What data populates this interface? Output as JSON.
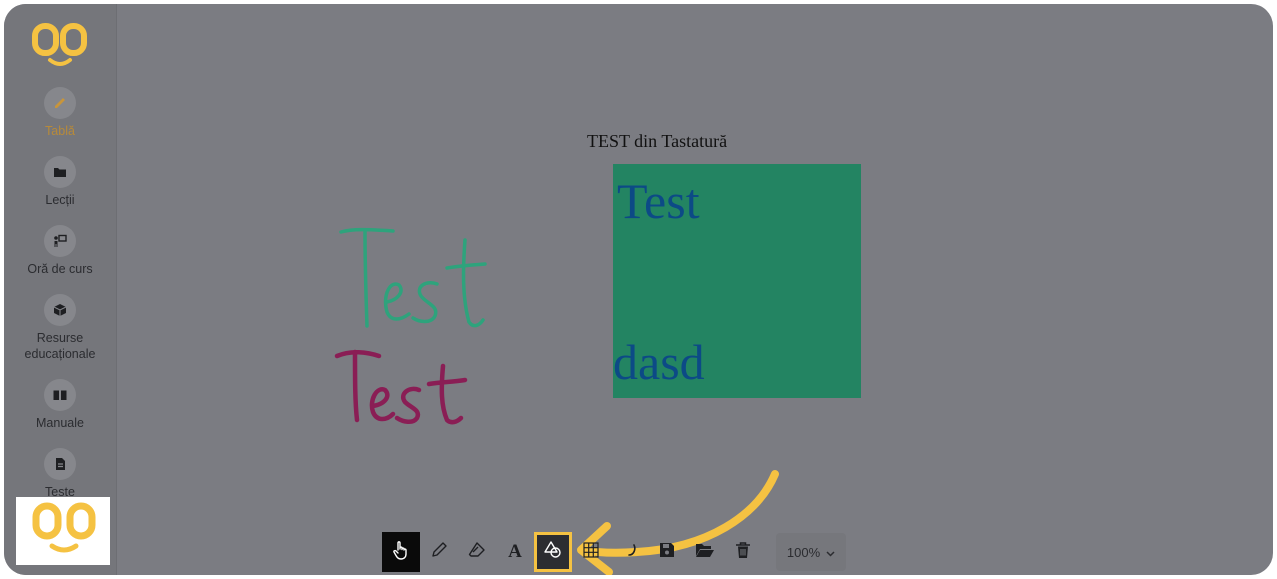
{
  "app": {
    "brand_color": "#f5c242",
    "accent_highlight": "#f5c242"
  },
  "sidebar": {
    "items": [
      {
        "label": "Tablă",
        "icon": "pencil-icon",
        "active": true
      },
      {
        "label": "Lecții",
        "icon": "folder-icon",
        "active": false
      },
      {
        "label": "Oră de curs",
        "icon": "teacher-board-icon",
        "active": false
      },
      {
        "label": "Resurse educaționale",
        "icon": "cube-icon",
        "active": false
      },
      {
        "label": "Manuale",
        "icon": "book-icon",
        "active": false
      },
      {
        "label": "Teste",
        "icon": "document-icon",
        "active": false
      }
    ]
  },
  "canvas": {
    "heading_text": "TEST din Tastatură",
    "handwritten": [
      {
        "text": "Test",
        "color": "#2ea37c"
      },
      {
        "text": "Test",
        "color": "#8a1e55"
      }
    ],
    "box": {
      "color": "#238462",
      "text_color": "#0c4a86",
      "lines": [
        "Test",
        "dasd"
      ]
    }
  },
  "toolbar": {
    "tools": [
      {
        "name": "hand-tool",
        "icon": "hand-pointer-icon",
        "selected": true
      },
      {
        "name": "pencil-tool",
        "icon": "pencil-outline-icon"
      },
      {
        "name": "eraser-tool",
        "icon": "eraser-icon"
      },
      {
        "name": "text-tool",
        "icon": "text-a-icon",
        "glyph": "A"
      },
      {
        "name": "shapes-tool",
        "icon": "shapes-icon",
        "highlighted": true
      },
      {
        "name": "grid-tool",
        "icon": "grid-icon"
      },
      {
        "name": "undo-tool",
        "icon": "undo-icon"
      },
      {
        "name": "save-tool",
        "icon": "save-icon"
      },
      {
        "name": "open-tool",
        "icon": "folder-open-icon"
      },
      {
        "name": "delete-tool",
        "icon": "trash-icon"
      }
    ],
    "zoom_value": "100%"
  }
}
